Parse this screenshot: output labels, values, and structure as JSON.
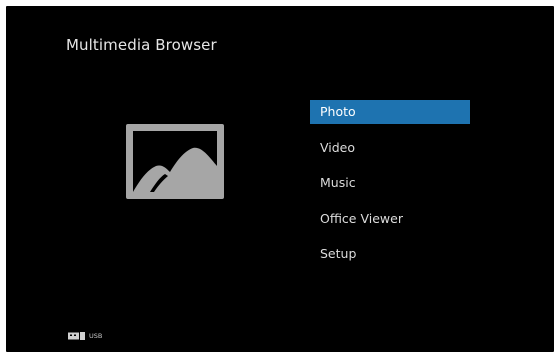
{
  "header": {
    "title": "Multimedia Browser"
  },
  "preview": {
    "icon": "photo-icon"
  },
  "menu": {
    "items": [
      {
        "label": "Photo",
        "selected": true
      },
      {
        "label": "Video",
        "selected": false
      },
      {
        "label": "Music",
        "selected": false
      },
      {
        "label": "Office Viewer",
        "selected": false
      },
      {
        "label": "Setup",
        "selected": false
      }
    ]
  },
  "footer": {
    "source_icon": "usb-icon",
    "source_label": "USB"
  },
  "colors": {
    "background": "#000000",
    "selection": "#1e73b0",
    "text": "#dcdcdc",
    "icon": "#a6a6a6"
  }
}
